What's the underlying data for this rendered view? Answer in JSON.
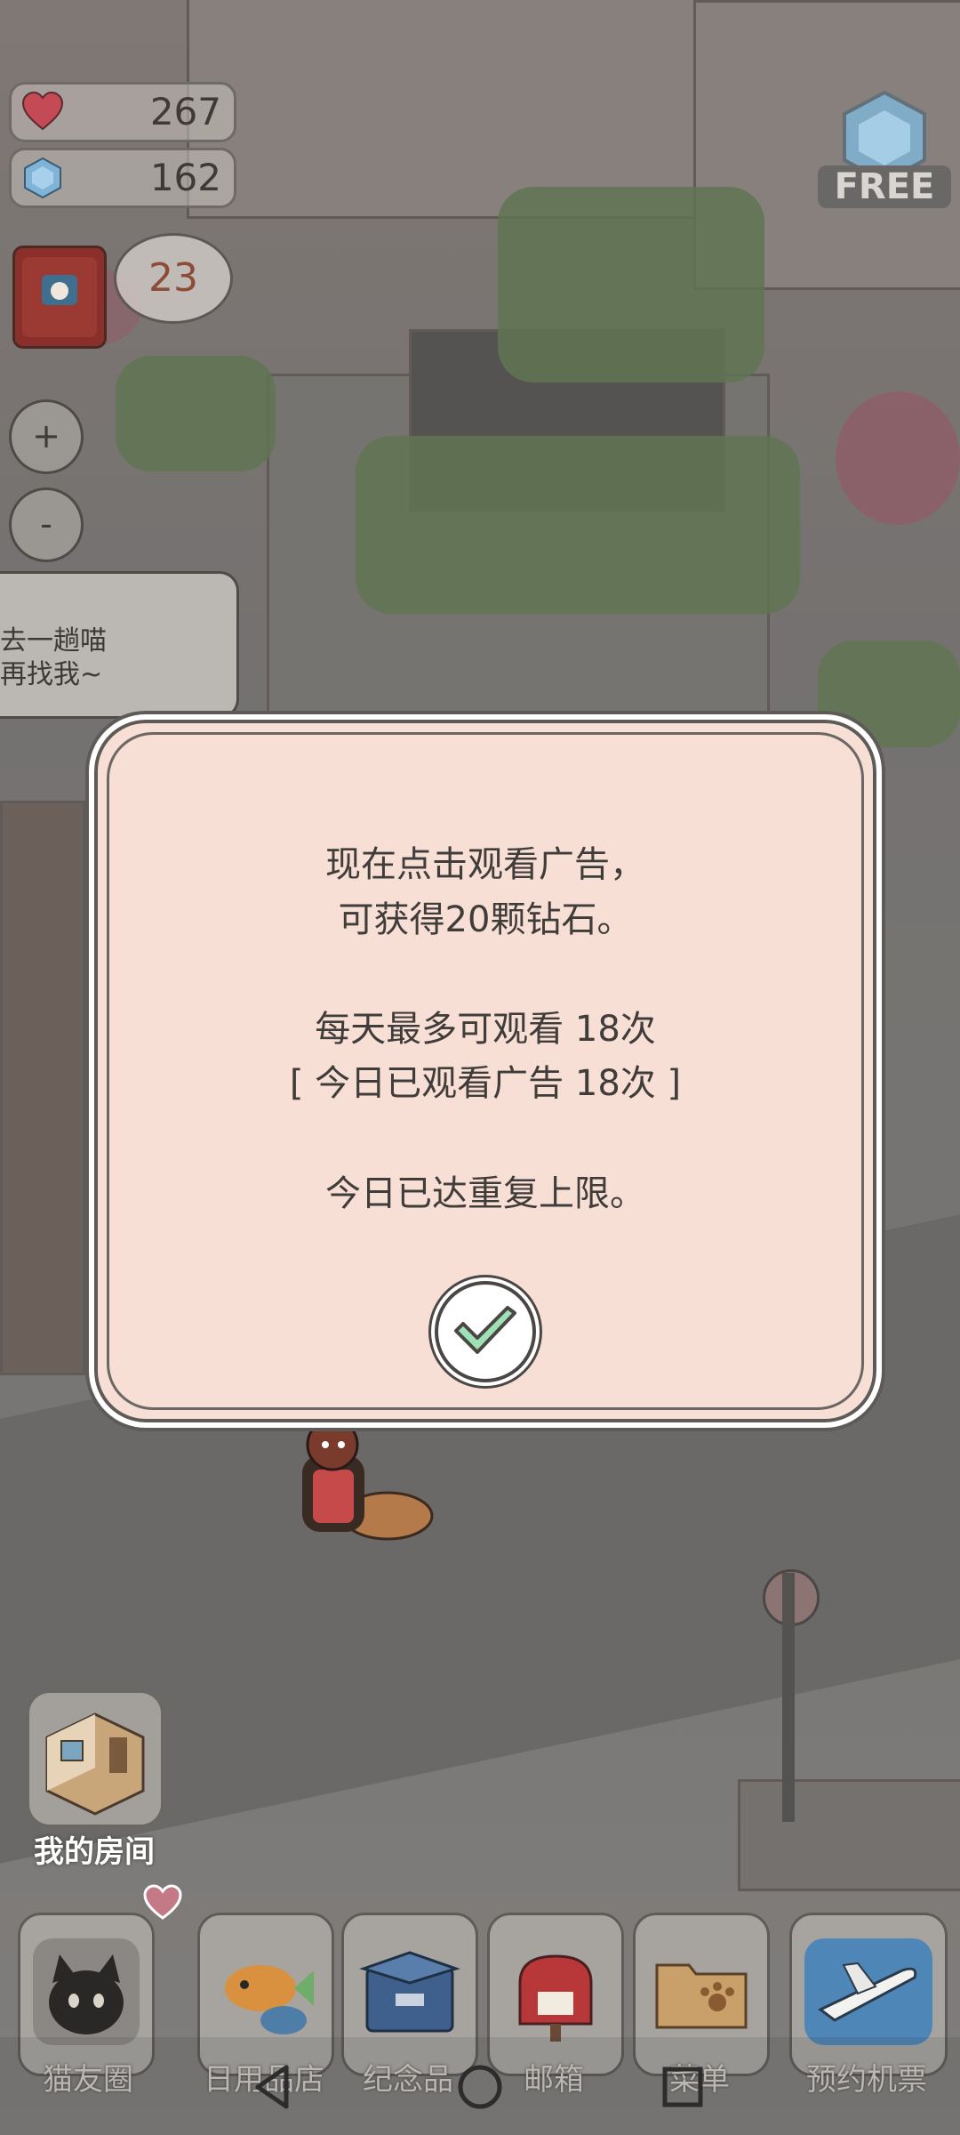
{
  "hud": {
    "hearts": "267",
    "gems": "162",
    "free_label": "FREE",
    "badge_count": "23",
    "zoom_in": "+",
    "zoom_out": "-"
  },
  "speech": {
    "line1": "去一趟喵",
    "line2": "再找我~"
  },
  "dialog": {
    "line1": "现在点击观看广告，",
    "line2": "可获得20颗钻石。",
    "line3": "每天最多可观看 18次",
    "line4": "[ 今日已观看广告 18次 ]",
    "line5": "今日已达重复上限。",
    "confirm_icon": "check-icon"
  },
  "my_room": {
    "label": "我的房间"
  },
  "bottom_bar": {
    "items": [
      {
        "label": "猫友圈",
        "icon": "cat-icon"
      },
      {
        "label": "日用品店",
        "icon": "fish-toy-icon"
      },
      {
        "label": "纪念品",
        "icon": "box-icon"
      },
      {
        "label": "邮箱",
        "icon": "mailbox-icon"
      },
      {
        "label": "菜单",
        "icon": "folder-icon"
      },
      {
        "label": "预约机票",
        "icon": "airplane-icon"
      }
    ]
  },
  "colors": {
    "dialog_bg": "#f8dfd5",
    "dialog_text": "#3f3c3a",
    "gem_blue": "#7fb4d6",
    "heart_red": "#c44b55",
    "check_green": "#9fe0b4"
  }
}
